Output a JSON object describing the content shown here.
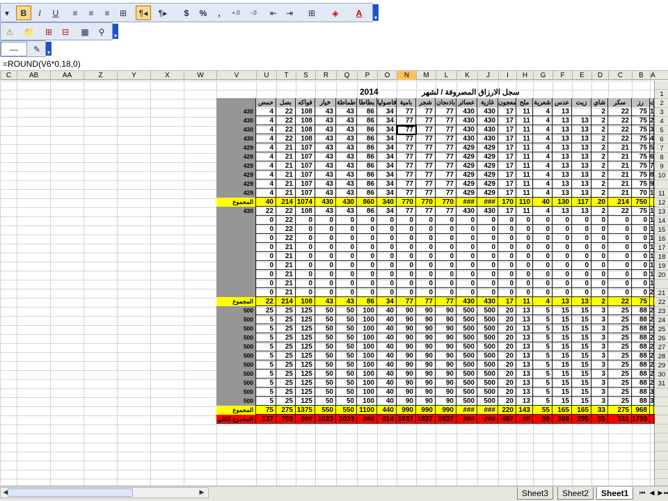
{
  "toolbar": {
    "font_size_arrow": "▾",
    "bold": "B",
    "italic": "I",
    "underline": "U",
    "align_left": "≡",
    "align_center": "≡",
    "align_right": "≡",
    "merge": "⊞",
    "rtl": "¶◂",
    "ltr": "¶▸",
    "currency": "$",
    "percent": "%",
    "comma": ",",
    "inc_decimal": "+.0",
    "dec_decimal": "-.0",
    "dec_indent": "⇤",
    "inc_indent": "⇥",
    "borders": "⊞",
    "fill_color": "◈",
    "font_color": "A",
    "more": "▾"
  },
  "toolbar2": {
    "items": [
      "⚠",
      "📁",
      "⊞",
      "⊟",
      "▦",
      "⚲"
    ],
    "more": "▾"
  },
  "toolbar3": {
    "line_style": "—",
    "draw": "✎",
    "more": "▾"
  },
  "formula_bar": {
    "text": "=ROUND(V6*0.18,0)"
  },
  "columns": [
    "C",
    "AB",
    "AA",
    "Z",
    "Y",
    "X",
    "W",
    "V",
    "U",
    "T",
    "S",
    "R",
    "Q",
    "P",
    "O",
    "N",
    "M",
    "L",
    "K",
    "J",
    "I",
    "H",
    "G",
    "F",
    "E",
    "D",
    "C",
    "B",
    "A"
  ],
  "selected_column": "N",
  "row_numbers": [
    "",
    "1",
    "2",
    "3",
    "4",
    "5",
    "6",
    "7",
    "8",
    "9",
    "10",
    "",
    "11",
    "12",
    "13",
    "14",
    "15",
    "16",
    "17",
    "18",
    "19",
    "20",
    "",
    "21",
    "22",
    "23",
    "24",
    "25",
    "26",
    "27",
    "28",
    "29",
    "30",
    "31",
    "",
    "",
    "",
    "",
    "",
    "",
    "",
    "",
    "",
    "",
    ""
  ],
  "sheet": {
    "title": "سجل الارزاق المصروفة / لشهر",
    "year": "2014",
    "headers": [
      "حمص",
      "بصل",
      "فواكه",
      "خيار",
      "طماطة",
      "بطاطا",
      "فاصوليا",
      "بامية",
      "شجر",
      "باذنجان",
      "عصائر",
      "غازية",
      "معجون",
      "ملح",
      "شعرية",
      "عدس",
      "زيت",
      "شاي",
      "سكر",
      "رز",
      "ت"
    ],
    "block1": [
      [
        "430",
        "4",
        "22",
        "108",
        "43",
        "43",
        "86",
        "34",
        "77",
        "77",
        "77",
        "430",
        "430",
        "17",
        "11",
        "4",
        "13",
        "",
        "2",
        "22",
        "75",
        "1"
      ],
      [
        "430",
        "4",
        "22",
        "108",
        "43",
        "43",
        "86",
        "34",
        "77",
        "77",
        "77",
        "430",
        "430",
        "17",
        "11",
        "4",
        "13",
        "13",
        "2",
        "22",
        "75",
        "2"
      ],
      [
        "430",
        "4",
        "22",
        "108",
        "43",
        "43",
        "86",
        "34",
        "77",
        "77",
        "77",
        "430",
        "430",
        "17",
        "11",
        "4",
        "13",
        "13",
        "2",
        "22",
        "75",
        "3"
      ],
      [
        "430",
        "4",
        "22",
        "108",
        "43",
        "43",
        "86",
        "34",
        "77",
        "77",
        "77",
        "430",
        "430",
        "17",
        "11",
        "4",
        "13",
        "13",
        "2",
        "22",
        "75",
        "4"
      ],
      [
        "429",
        "4",
        "21",
        "107",
        "43",
        "43",
        "86",
        "34",
        "77",
        "77",
        "77",
        "429",
        "429",
        "17",
        "11",
        "4",
        "13",
        "13",
        "2",
        "21",
        "75",
        "5"
      ],
      [
        "429",
        "4",
        "21",
        "107",
        "43",
        "43",
        "86",
        "34",
        "77",
        "77",
        "77",
        "429",
        "429",
        "17",
        "11",
        "4",
        "13",
        "13",
        "2",
        "21",
        "75",
        "6"
      ],
      [
        "429",
        "4",
        "21",
        "107",
        "43",
        "43",
        "86",
        "34",
        "77",
        "77",
        "77",
        "429",
        "429",
        "17",
        "11",
        "4",
        "13",
        "13",
        "2",
        "21",
        "75",
        "7"
      ],
      [
        "429",
        "4",
        "21",
        "107",
        "43",
        "43",
        "86",
        "34",
        "77",
        "77",
        "77",
        "429",
        "429",
        "17",
        "11",
        "4",
        "13",
        "13",
        "2",
        "21",
        "75",
        "8"
      ],
      [
        "429",
        "4",
        "21",
        "107",
        "43",
        "43",
        "86",
        "34",
        "77",
        "77",
        "77",
        "429",
        "429",
        "17",
        "11",
        "4",
        "13",
        "13",
        "2",
        "21",
        "75",
        "9"
      ],
      [
        "429",
        "4",
        "21",
        "107",
        "43",
        "43",
        "86",
        "34",
        "77",
        "77",
        "77",
        "429",
        "429",
        "17",
        "11",
        "4",
        "13",
        "13",
        "2",
        "21",
        "70",
        "10"
      ]
    ],
    "total1": [
      "المجموع",
      "40",
      "214",
      "1074",
      "430",
      "430",
      "860",
      "340",
      "770",
      "770",
      "770",
      "###",
      "###",
      "170",
      "110",
      "40",
      "130",
      "117",
      "20",
      "214",
      "750",
      ""
    ],
    "block2": [
      [
        "430",
        "22",
        "22",
        "108",
        "43",
        "43",
        "86",
        "34",
        "77",
        "77",
        "77",
        "430",
        "430",
        "17",
        "11",
        "4",
        "13",
        "13",
        "2",
        "22",
        "75",
        "11"
      ],
      [
        "",
        "0",
        "22",
        "0",
        "0",
        "0",
        "0",
        "0",
        "0",
        "0",
        "0",
        "0",
        "0",
        "0",
        "0",
        "0",
        "0",
        "0",
        "0",
        "0",
        "0",
        "12"
      ],
      [
        "",
        "0",
        "22",
        "0",
        "0",
        "0",
        "0",
        "0",
        "0",
        "0",
        "0",
        "0",
        "0",
        "0",
        "0",
        "0",
        "0",
        "0",
        "0",
        "0",
        "0",
        "13"
      ],
      [
        "",
        "0",
        "22",
        "0",
        "0",
        "0",
        "0",
        "0",
        "0",
        "0",
        "0",
        "0",
        "0",
        "0",
        "0",
        "0",
        "0",
        "0",
        "0",
        "0",
        "0",
        "14"
      ],
      [
        "",
        "0",
        "21",
        "0",
        "0",
        "0",
        "0",
        "0",
        "0",
        "0",
        "0",
        "0",
        "0",
        "0",
        "0",
        "0",
        "0",
        "0",
        "0",
        "0",
        "0",
        "15"
      ],
      [
        "",
        "0",
        "21",
        "0",
        "0",
        "0",
        "0",
        "0",
        "0",
        "0",
        "0",
        "0",
        "0",
        "0",
        "0",
        "0",
        "0",
        "0",
        "0",
        "0",
        "0",
        "16"
      ],
      [
        "",
        "0",
        "21",
        "0",
        "0",
        "0",
        "0",
        "0",
        "0",
        "0",
        "0",
        "0",
        "0",
        "0",
        "0",
        "0",
        "0",
        "0",
        "0",
        "0",
        "0",
        "17"
      ],
      [
        "",
        "0",
        "21",
        "0",
        "0",
        "0",
        "0",
        "0",
        "0",
        "0",
        "0",
        "0",
        "0",
        "0",
        "0",
        "0",
        "0",
        "0",
        "0",
        "0",
        "0",
        "18"
      ],
      [
        "",
        "0",
        "21",
        "0",
        "0",
        "0",
        "0",
        "0",
        "0",
        "0",
        "0",
        "0",
        "0",
        "0",
        "0",
        "0",
        "0",
        "0",
        "0",
        "0",
        "0",
        "19"
      ],
      [
        "",
        "0",
        "21",
        "0",
        "0",
        "0",
        "0",
        "0",
        "0",
        "0",
        "0",
        "0",
        "0",
        "0",
        "0",
        "0",
        "0",
        "0",
        "0",
        "0",
        "0",
        "20"
      ]
    ],
    "total2": [
      "المجموع",
      "22",
      "214",
      "108",
      "43",
      "43",
      "86",
      "34",
      "77",
      "77",
      "77",
      "430",
      "430",
      "17",
      "11",
      "4",
      "13",
      "13",
      "2",
      "22",
      "75",
      ""
    ],
    "block3": [
      [
        "500",
        "25",
        "25",
        "125",
        "50",
        "50",
        "100",
        "40",
        "90",
        "90",
        "90",
        "500",
        "500",
        "20",
        "13",
        "5",
        "15",
        "15",
        "3",
        "25",
        "88",
        "21"
      ],
      [
        "500",
        "5",
        "25",
        "125",
        "50",
        "50",
        "100",
        "40",
        "90",
        "90",
        "90",
        "500",
        "500",
        "20",
        "13",
        "5",
        "15",
        "15",
        "3",
        "25",
        "88",
        "22"
      ],
      [
        "500",
        "5",
        "25",
        "125",
        "50",
        "50",
        "100",
        "40",
        "90",
        "90",
        "90",
        "500",
        "500",
        "20",
        "13",
        "5",
        "15",
        "15",
        "3",
        "25",
        "88",
        "23"
      ],
      [
        "500",
        "5",
        "25",
        "125",
        "50",
        "50",
        "100",
        "40",
        "90",
        "90",
        "90",
        "500",
        "500",
        "20",
        "13",
        "5",
        "15",
        "15",
        "3",
        "25",
        "88",
        "24"
      ],
      [
        "500",
        "5",
        "25",
        "125",
        "50",
        "50",
        "100",
        "40",
        "90",
        "90",
        "90",
        "500",
        "500",
        "20",
        "13",
        "5",
        "15",
        "15",
        "3",
        "25",
        "88",
        "25"
      ],
      [
        "500",
        "5",
        "25",
        "125",
        "50",
        "50",
        "100",
        "40",
        "90",
        "90",
        "90",
        "500",
        "500",
        "20",
        "13",
        "5",
        "15",
        "15",
        "3",
        "25",
        "88",
        "26"
      ],
      [
        "500",
        "5",
        "25",
        "125",
        "50",
        "50",
        "100",
        "40",
        "90",
        "90",
        "90",
        "500",
        "500",
        "20",
        "13",
        "5",
        "15",
        "15",
        "3",
        "25",
        "88",
        "27"
      ],
      [
        "500",
        "5",
        "25",
        "125",
        "50",
        "50",
        "100",
        "40",
        "90",
        "90",
        "90",
        "500",
        "500",
        "20",
        "13",
        "5",
        "15",
        "15",
        "3",
        "25",
        "88",
        "28"
      ],
      [
        "500",
        "5",
        "25",
        "125",
        "50",
        "50",
        "100",
        "40",
        "90",
        "90",
        "90",
        "500",
        "500",
        "20",
        "13",
        "5",
        "15",
        "15",
        "3",
        "25",
        "88",
        "29"
      ],
      [
        "500",
        "5",
        "25",
        "125",
        "50",
        "50",
        "100",
        "40",
        "90",
        "90",
        "90",
        "500",
        "500",
        "20",
        "13",
        "5",
        "15",
        "15",
        "3",
        "25",
        "88",
        "30"
      ],
      [
        "500",
        "5",
        "25",
        "125",
        "50",
        "50",
        "100",
        "40",
        "90",
        "90",
        "90",
        "500",
        "500",
        "20",
        "13",
        "5",
        "15",
        "15",
        "3",
        "25",
        "88",
        "31"
      ]
    ],
    "total3": [
      "المجموع",
      "75",
      "275",
      "1375",
      "550",
      "550",
      "1100",
      "440",
      "990",
      "990",
      "990",
      "###",
      "###",
      "220",
      "143",
      "55",
      "165",
      "165",
      "33",
      "275",
      "968",
      ""
    ],
    "grand_total": [
      "المجموع الكلي",
      "137",
      "703",
      "###",
      "1023",
      "1023",
      "###",
      "814",
      "1837",
      "1837",
      "1837",
      "###",
      "###",
      "407",
      "##",
      "99",
      "308",
      "295",
      "55",
      "511",
      "1793",
      ""
    ]
  },
  "tabs": [
    "Sheet3",
    "Sheet2",
    "Sheet1"
  ],
  "active_tab": "Sheet1",
  "tab_nav": [
    "⏮",
    "◀",
    "▶",
    "⏭"
  ],
  "scroll": {
    "left_arrow": "◀",
    "right_arrow": "▶"
  }
}
